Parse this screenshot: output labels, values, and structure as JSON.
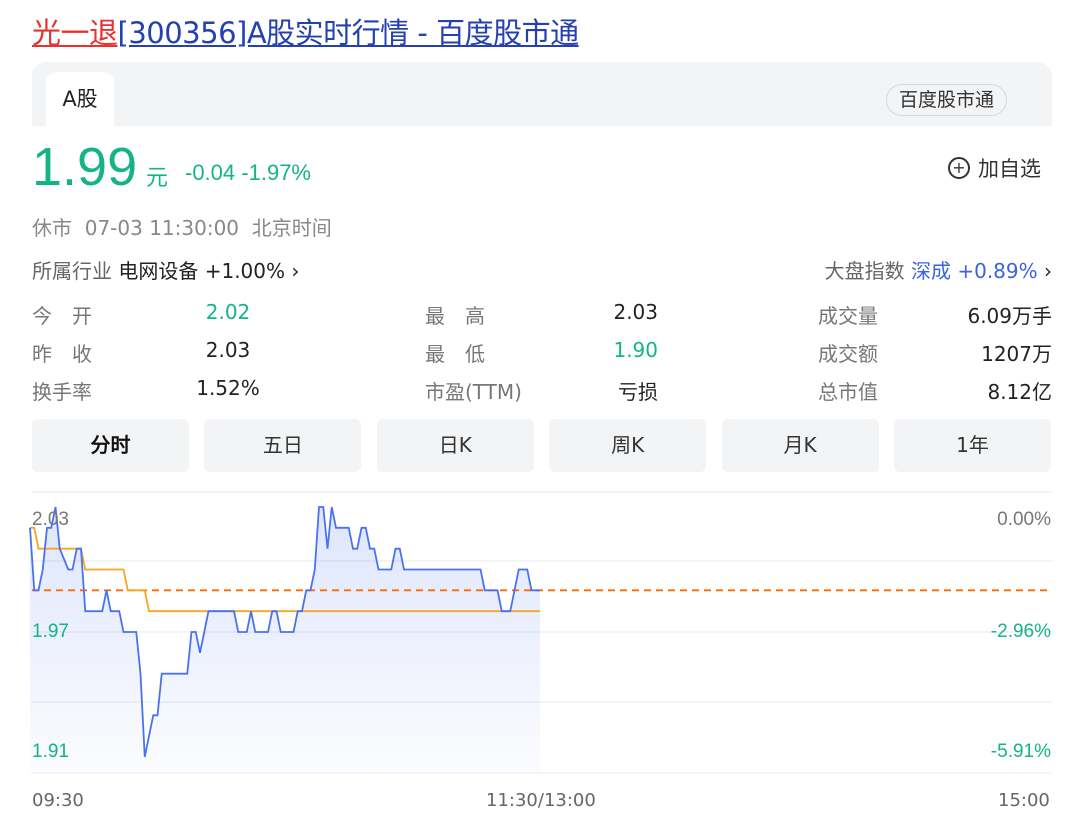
{
  "title": {
    "name": "光一退",
    "rest": "[300356]A股实时行情 - 百度股市通"
  },
  "tabs": {
    "active": "A股",
    "brand": "百度股市通"
  },
  "quote": {
    "price": "1.99",
    "unit": "元",
    "change": "-0.04",
    "change_pct": "-1.97%",
    "add_watchlist": "加自选"
  },
  "status": {
    "state": "休市",
    "datetime": "07-03 11:30:00",
    "tz": "北京时间"
  },
  "industry": {
    "label": "所属行业",
    "name": "电网设备",
    "change": "+1.00%"
  },
  "market_index": {
    "label": "大盘指数",
    "name": "深成",
    "change": "+0.89%"
  },
  "stats": [
    {
      "label": "今　开",
      "value": "2.02",
      "color": "#14b487"
    },
    {
      "label": "最　高",
      "value": "2.03",
      "color": "#222"
    },
    {
      "label": "成交量",
      "value": "6.09万手",
      "color": "#222"
    },
    {
      "label": "昨　收",
      "value": "2.03",
      "color": "#222"
    },
    {
      "label": "最　低",
      "value": "1.90",
      "color": "#14b487"
    },
    {
      "label": "成交额",
      "value": "1207万",
      "color": "#222"
    },
    {
      "label": "换手率",
      "value": "1.52%",
      "color": "#222"
    },
    {
      "label": "市盈(TTM)",
      "value": "亏损",
      "color": "#222"
    },
    {
      "label": "总市值",
      "value": "8.12亿",
      "color": "#222"
    }
  ],
  "periods": [
    "分时",
    "五日",
    "日K",
    "周K",
    "月K",
    "1年"
  ],
  "active_period": "分时",
  "colors": {
    "down": "#14b487",
    "up": "#e9312f",
    "price_line": "#4a72f0",
    "avg_line": "#f5a623",
    "current_line": "#ff6a00"
  },
  "chart_data": {
    "type": "line",
    "y_labels_left": [
      "2.03",
      "1.97",
      "1.91"
    ],
    "y_labels_right": [
      "0.00%",
      "-2.96%",
      "-5.91%"
    ],
    "x_labels": [
      "09:30",
      "11:30/13:00",
      "15:00"
    ],
    "ylim": [
      1.91,
      2.03
    ],
    "current_price": 1.99,
    "series": [
      {
        "key": "price",
        "points": [
          [
            "09:30",
            2.02
          ],
          [
            "09:31",
            1.99
          ],
          [
            "09:32",
            1.99
          ],
          [
            "09:33",
            2.0
          ],
          [
            "09:34",
            2.02
          ],
          [
            "09:35",
            2.02
          ],
          [
            "09:36",
            2.03
          ],
          [
            "09:37",
            2.01
          ],
          [
            "09:39",
            2.0
          ],
          [
            "09:40",
            2.0
          ],
          [
            "09:41",
            2.01
          ],
          [
            "09:42",
            2.01
          ],
          [
            "09:43",
            1.98
          ],
          [
            "09:47",
            1.98
          ],
          [
            "09:48",
            1.99
          ],
          [
            "09:49",
            1.98
          ],
          [
            "09:51",
            1.98
          ],
          [
            "09:52",
            1.97
          ],
          [
            "09:55",
            1.97
          ],
          [
            "09:56",
            1.95
          ],
          [
            "09:57",
            1.91
          ],
          [
            "09:59",
            1.93
          ],
          [
            "10:00",
            1.93
          ],
          [
            "10:01",
            1.95
          ],
          [
            "10:07",
            1.95
          ],
          [
            "10:08",
            1.97
          ],
          [
            "10:09",
            1.97
          ],
          [
            "10:10",
            1.96
          ],
          [
            "10:12",
            1.98
          ],
          [
            "10:18",
            1.98
          ],
          [
            "10:19",
            1.97
          ],
          [
            "10:21",
            1.97
          ],
          [
            "10:22",
            1.98
          ],
          [
            "10:23",
            1.97
          ],
          [
            "10:26",
            1.97
          ],
          [
            "10:27",
            1.98
          ],
          [
            "10:28",
            1.98
          ],
          [
            "10:29",
            1.97
          ],
          [
            "10:32",
            1.97
          ],
          [
            "10:33",
            1.98
          ],
          [
            "10:34",
            1.98
          ],
          [
            "10:35",
            1.99
          ],
          [
            "10:36",
            1.99
          ],
          [
            "10:37",
            2.0
          ],
          [
            "10:38",
            2.03
          ],
          [
            "10:39",
            2.03
          ],
          [
            "10:40",
            2.01
          ],
          [
            "10:41",
            2.03
          ],
          [
            "10:42",
            2.02
          ],
          [
            "10:45",
            2.02
          ],
          [
            "10:46",
            2.01
          ],
          [
            "10:47",
            2.01
          ],
          [
            "10:48",
            2.02
          ],
          [
            "10:49",
            2.02
          ],
          [
            "10:50",
            2.01
          ],
          [
            "10:51",
            2.01
          ],
          [
            "10:52",
            2.0
          ],
          [
            "10:55",
            2.0
          ],
          [
            "10:56",
            2.01
          ],
          [
            "10:57",
            2.01
          ],
          [
            "10:58",
            2.0
          ],
          [
            "11:16",
            2.0
          ],
          [
            "11:17",
            1.99
          ],
          [
            "11:20",
            1.99
          ],
          [
            "11:21",
            1.98
          ],
          [
            "11:23",
            1.98
          ],
          [
            "11:25",
            2.0
          ],
          [
            "11:27",
            2.0
          ],
          [
            "11:28",
            1.99
          ],
          [
            "11:30",
            1.99
          ]
        ]
      },
      {
        "key": "average",
        "points": [
          [
            "09:30",
            2.02
          ],
          [
            "09:31",
            2.02
          ],
          [
            "09:32",
            2.01
          ],
          [
            "09:42",
            2.01
          ],
          [
            "09:43",
            2.0
          ],
          [
            "09:52",
            2.0
          ],
          [
            "09:53",
            1.99
          ],
          [
            "09:57",
            1.99
          ],
          [
            "09:58",
            1.98
          ],
          [
            "11:30",
            1.98
          ]
        ]
      }
    ]
  }
}
